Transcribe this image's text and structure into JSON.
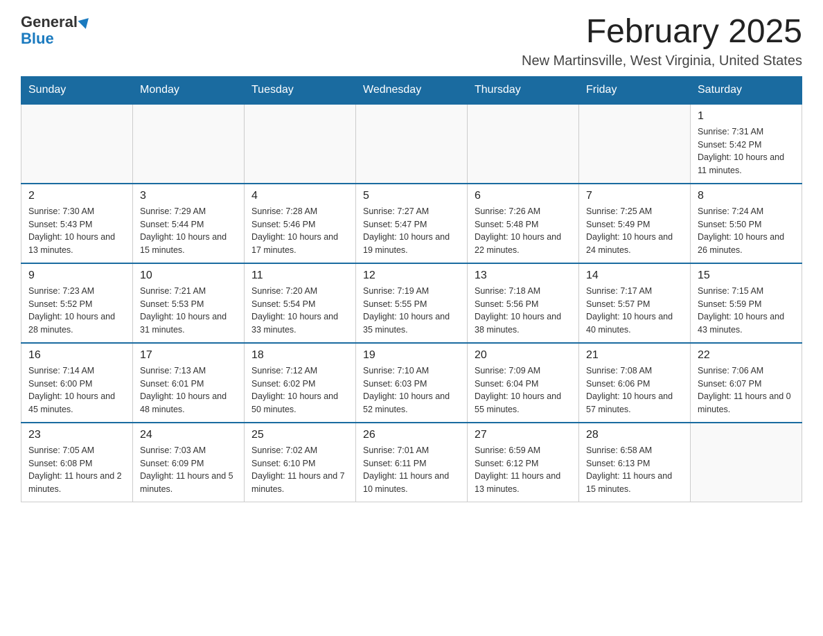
{
  "header": {
    "logo_general": "General",
    "logo_blue": "Blue",
    "month_title": "February 2025",
    "location": "New Martinsville, West Virginia, United States"
  },
  "weekdays": [
    "Sunday",
    "Monday",
    "Tuesday",
    "Wednesday",
    "Thursday",
    "Friday",
    "Saturday"
  ],
  "weeks": [
    [
      {
        "day": "",
        "sunrise": "",
        "sunset": "",
        "daylight": ""
      },
      {
        "day": "",
        "sunrise": "",
        "sunset": "",
        "daylight": ""
      },
      {
        "day": "",
        "sunrise": "",
        "sunset": "",
        "daylight": ""
      },
      {
        "day": "",
        "sunrise": "",
        "sunset": "",
        "daylight": ""
      },
      {
        "day": "",
        "sunrise": "",
        "sunset": "",
        "daylight": ""
      },
      {
        "day": "",
        "sunrise": "",
        "sunset": "",
        "daylight": ""
      },
      {
        "day": "1",
        "sunrise": "Sunrise: 7:31 AM",
        "sunset": "Sunset: 5:42 PM",
        "daylight": "Daylight: 10 hours and 11 minutes."
      }
    ],
    [
      {
        "day": "2",
        "sunrise": "Sunrise: 7:30 AM",
        "sunset": "Sunset: 5:43 PM",
        "daylight": "Daylight: 10 hours and 13 minutes."
      },
      {
        "day": "3",
        "sunrise": "Sunrise: 7:29 AM",
        "sunset": "Sunset: 5:44 PM",
        "daylight": "Daylight: 10 hours and 15 minutes."
      },
      {
        "day": "4",
        "sunrise": "Sunrise: 7:28 AM",
        "sunset": "Sunset: 5:46 PM",
        "daylight": "Daylight: 10 hours and 17 minutes."
      },
      {
        "day": "5",
        "sunrise": "Sunrise: 7:27 AM",
        "sunset": "Sunset: 5:47 PM",
        "daylight": "Daylight: 10 hours and 19 minutes."
      },
      {
        "day": "6",
        "sunrise": "Sunrise: 7:26 AM",
        "sunset": "Sunset: 5:48 PM",
        "daylight": "Daylight: 10 hours and 22 minutes."
      },
      {
        "day": "7",
        "sunrise": "Sunrise: 7:25 AM",
        "sunset": "Sunset: 5:49 PM",
        "daylight": "Daylight: 10 hours and 24 minutes."
      },
      {
        "day": "8",
        "sunrise": "Sunrise: 7:24 AM",
        "sunset": "Sunset: 5:50 PM",
        "daylight": "Daylight: 10 hours and 26 minutes."
      }
    ],
    [
      {
        "day": "9",
        "sunrise": "Sunrise: 7:23 AM",
        "sunset": "Sunset: 5:52 PM",
        "daylight": "Daylight: 10 hours and 28 minutes."
      },
      {
        "day": "10",
        "sunrise": "Sunrise: 7:21 AM",
        "sunset": "Sunset: 5:53 PM",
        "daylight": "Daylight: 10 hours and 31 minutes."
      },
      {
        "day": "11",
        "sunrise": "Sunrise: 7:20 AM",
        "sunset": "Sunset: 5:54 PM",
        "daylight": "Daylight: 10 hours and 33 minutes."
      },
      {
        "day": "12",
        "sunrise": "Sunrise: 7:19 AM",
        "sunset": "Sunset: 5:55 PM",
        "daylight": "Daylight: 10 hours and 35 minutes."
      },
      {
        "day": "13",
        "sunrise": "Sunrise: 7:18 AM",
        "sunset": "Sunset: 5:56 PM",
        "daylight": "Daylight: 10 hours and 38 minutes."
      },
      {
        "day": "14",
        "sunrise": "Sunrise: 7:17 AM",
        "sunset": "Sunset: 5:57 PM",
        "daylight": "Daylight: 10 hours and 40 minutes."
      },
      {
        "day": "15",
        "sunrise": "Sunrise: 7:15 AM",
        "sunset": "Sunset: 5:59 PM",
        "daylight": "Daylight: 10 hours and 43 minutes."
      }
    ],
    [
      {
        "day": "16",
        "sunrise": "Sunrise: 7:14 AM",
        "sunset": "Sunset: 6:00 PM",
        "daylight": "Daylight: 10 hours and 45 minutes."
      },
      {
        "day": "17",
        "sunrise": "Sunrise: 7:13 AM",
        "sunset": "Sunset: 6:01 PM",
        "daylight": "Daylight: 10 hours and 48 minutes."
      },
      {
        "day": "18",
        "sunrise": "Sunrise: 7:12 AM",
        "sunset": "Sunset: 6:02 PM",
        "daylight": "Daylight: 10 hours and 50 minutes."
      },
      {
        "day": "19",
        "sunrise": "Sunrise: 7:10 AM",
        "sunset": "Sunset: 6:03 PM",
        "daylight": "Daylight: 10 hours and 52 minutes."
      },
      {
        "day": "20",
        "sunrise": "Sunrise: 7:09 AM",
        "sunset": "Sunset: 6:04 PM",
        "daylight": "Daylight: 10 hours and 55 minutes."
      },
      {
        "day": "21",
        "sunrise": "Sunrise: 7:08 AM",
        "sunset": "Sunset: 6:06 PM",
        "daylight": "Daylight: 10 hours and 57 minutes."
      },
      {
        "day": "22",
        "sunrise": "Sunrise: 7:06 AM",
        "sunset": "Sunset: 6:07 PM",
        "daylight": "Daylight: 11 hours and 0 minutes."
      }
    ],
    [
      {
        "day": "23",
        "sunrise": "Sunrise: 7:05 AM",
        "sunset": "Sunset: 6:08 PM",
        "daylight": "Daylight: 11 hours and 2 minutes."
      },
      {
        "day": "24",
        "sunrise": "Sunrise: 7:03 AM",
        "sunset": "Sunset: 6:09 PM",
        "daylight": "Daylight: 11 hours and 5 minutes."
      },
      {
        "day": "25",
        "sunrise": "Sunrise: 7:02 AM",
        "sunset": "Sunset: 6:10 PM",
        "daylight": "Daylight: 11 hours and 7 minutes."
      },
      {
        "day": "26",
        "sunrise": "Sunrise: 7:01 AM",
        "sunset": "Sunset: 6:11 PM",
        "daylight": "Daylight: 11 hours and 10 minutes."
      },
      {
        "day": "27",
        "sunrise": "Sunrise: 6:59 AM",
        "sunset": "Sunset: 6:12 PM",
        "daylight": "Daylight: 11 hours and 13 minutes."
      },
      {
        "day": "28",
        "sunrise": "Sunrise: 6:58 AM",
        "sunset": "Sunset: 6:13 PM",
        "daylight": "Daylight: 11 hours and 15 minutes."
      },
      {
        "day": "",
        "sunrise": "",
        "sunset": "",
        "daylight": ""
      }
    ]
  ]
}
